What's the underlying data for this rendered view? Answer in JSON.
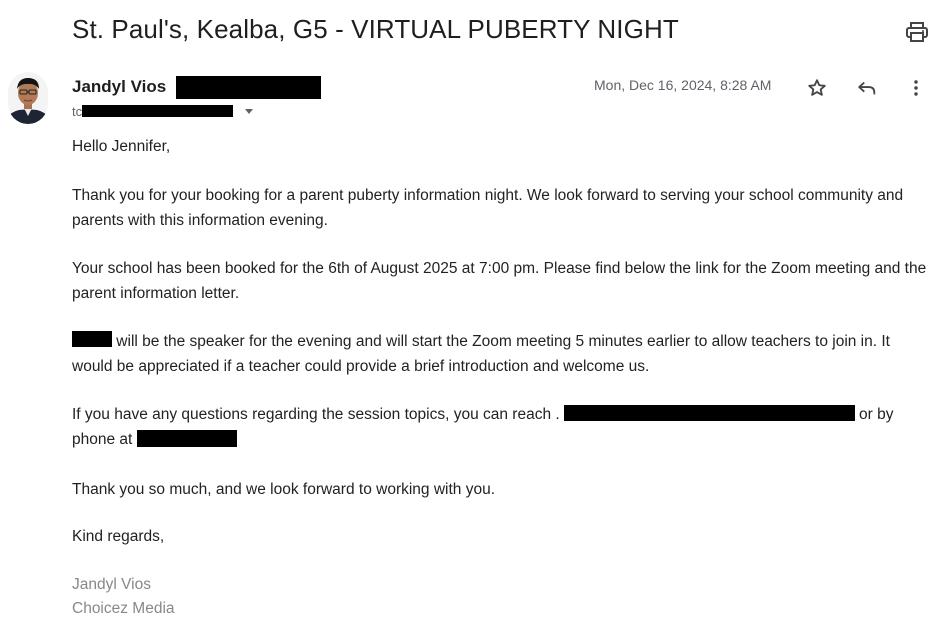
{
  "email": {
    "subject": "St. Paul's, Kealba, G5 - VIRTUAL PUBERTY NIGHT",
    "sender_name": "Jandyl Vios",
    "to_prefix": "tc",
    "date": "Mon, Dec 16, 2024, 8:28 AM",
    "greeting": "Hello Jennifer,",
    "paragraph_1": "Thank you for your booking for a parent puberty information night. We look forward to serving your school community and parents with this information evening.",
    "paragraph_2": "Your school has been booked for the 6th of August 2025 at 7:00 pm. Please find below the link for the Zoom meeting and the parent information letter.",
    "paragraph_3_rest": " will be the speaker for the evening and will start the Zoom meeting 5 minutes earlier to allow teachers to join in. It would be appreciated if a teacher could provide a brief introduction and welcome us.",
    "paragraph_4_start": "If you have any questions regarding the session topics, you can reach .",
    "paragraph_4_middle": " or by phone at ",
    "paragraph_5": "Thank you so much, and we look forward to working with you.",
    "closing": "Kind regards,",
    "signature_name": "Jandyl Vios",
    "signature_company": "Choicez Media"
  },
  "icons": {
    "print": "print-icon",
    "star": "star-icon",
    "reply": "reply-icon",
    "more": "more-vert-icon",
    "expand": "caret-down-icon"
  },
  "colors": {
    "text": "#222222",
    "muted": "#5f6368",
    "signature": "#888888",
    "redaction": "#000000"
  }
}
